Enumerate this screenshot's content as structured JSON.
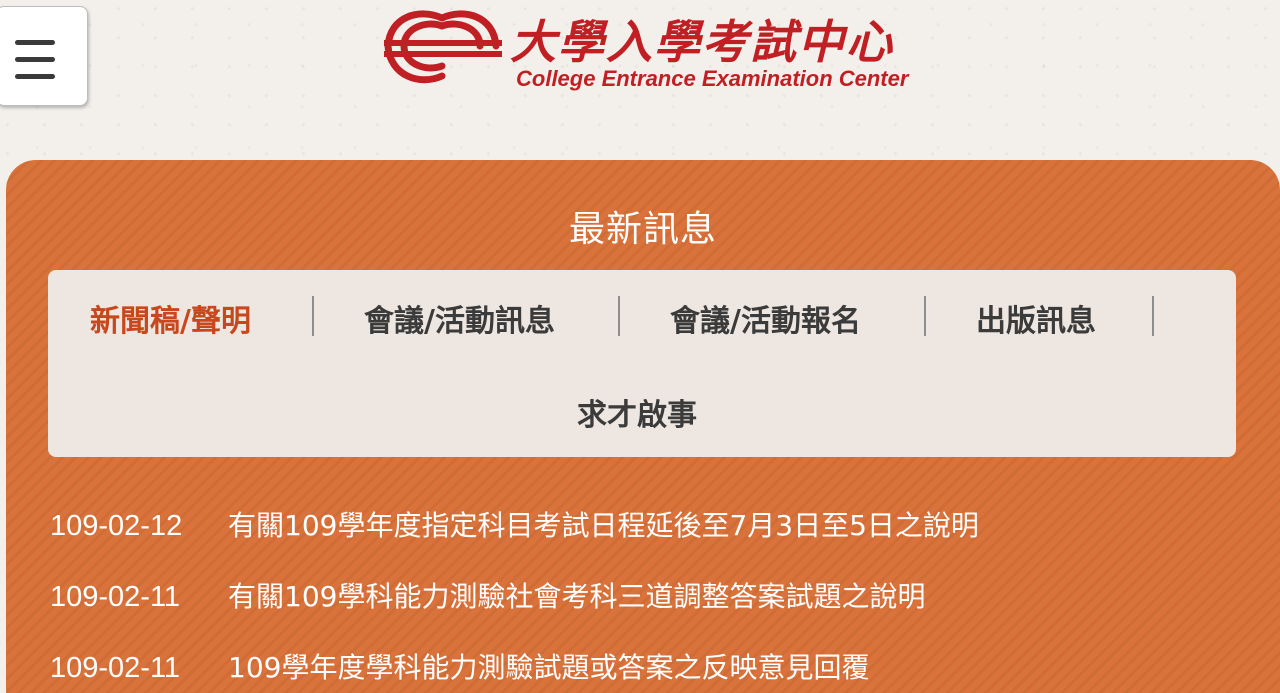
{
  "header": {
    "menu_icon": "hamburger-menu-icon",
    "logo_text_cn": "大學入學考試中心",
    "logo_text_en": "College Entrance Examination Center",
    "brand_color": "#c01f24"
  },
  "news": {
    "title": "最新訊息",
    "panel_color": "#d9733b",
    "active_color": "#c8471c",
    "tabs": [
      {
        "label": "新聞稿/聲明",
        "active": true
      },
      {
        "label": "會議/活動訊息",
        "active": false
      },
      {
        "label": "會議/活動報名",
        "active": false
      },
      {
        "label": "出版訊息",
        "active": false
      },
      {
        "label": "求才啟事",
        "active": false
      }
    ],
    "items": [
      {
        "date": "109-02-12",
        "title": "有關109學年度指定科目考試日程延後至7月3日至5日之說明"
      },
      {
        "date": "109-02-11",
        "title": "有關109學科能力測驗社會考科三道調整答案試題之說明"
      },
      {
        "date": "109-02-11",
        "title": "109學年度學科能力測驗試題或答案之反映意見回覆"
      }
    ]
  }
}
